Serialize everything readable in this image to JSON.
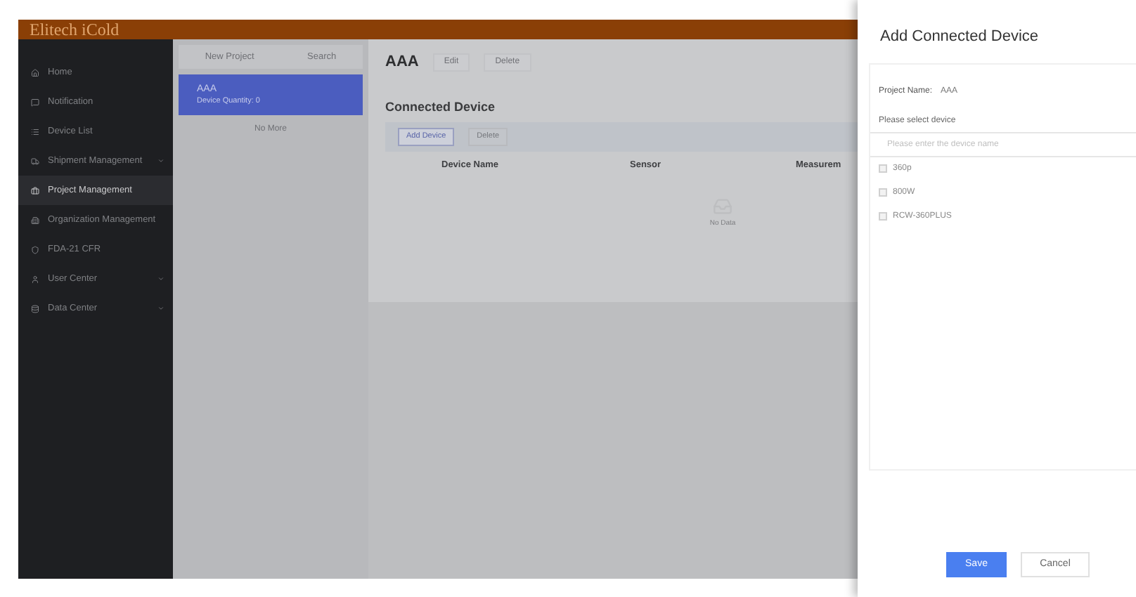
{
  "logo": {
    "text": "Elitech iCold"
  },
  "sidebar": {
    "items": [
      {
        "label": "Home",
        "selected": false,
        "expandable": false
      },
      {
        "label": "Notification",
        "selected": false,
        "expandable": false
      },
      {
        "label": "Device List",
        "selected": false,
        "expandable": false
      },
      {
        "label": "Shipment Management",
        "selected": false,
        "expandable": true
      },
      {
        "label": "Project Management",
        "selected": true,
        "expandable": false
      },
      {
        "label": "Organization Management",
        "selected": false,
        "expandable": false
      },
      {
        "label": "FDA-21 CFR",
        "selected": false,
        "expandable": false
      },
      {
        "label": "User Center",
        "selected": false,
        "expandable": true
      },
      {
        "label": "Data Center",
        "selected": false,
        "expandable": true
      }
    ]
  },
  "projects": {
    "actions": [
      "New Project",
      "Search"
    ],
    "items": [
      {
        "name": "AAA",
        "detail": "Device Quantity: 0",
        "selected": true
      }
    ],
    "footer": "No More"
  },
  "project": {
    "title": "AAA",
    "actions": [
      "Edit",
      "Delete"
    ]
  },
  "connected": {
    "title": "Connected Device",
    "buttons": [
      {
        "label": "Add Device",
        "disabled": false
      },
      {
        "label": "Delete",
        "disabled": true
      }
    ],
    "columns": [
      "Device Name",
      "Sensor",
      "Measurem"
    ],
    "empty": "No Data"
  },
  "drawer": {
    "title": "Add Connected Device",
    "project_label": "Project Name:",
    "project_value": "AAA",
    "select_label": "Please select device",
    "search": {
      "placeholder": "Please enter the device name"
    },
    "devices": [
      {
        "label": "360p",
        "checked": false
      },
      {
        "label": "800W",
        "checked": false
      },
      {
        "label": "RCW-360PLUS",
        "checked": false
      }
    ],
    "buttons": [
      {
        "label": "Save",
        "kind": "primary"
      },
      {
        "label": "Cancel",
        "kind": "default"
      }
    ]
  }
}
